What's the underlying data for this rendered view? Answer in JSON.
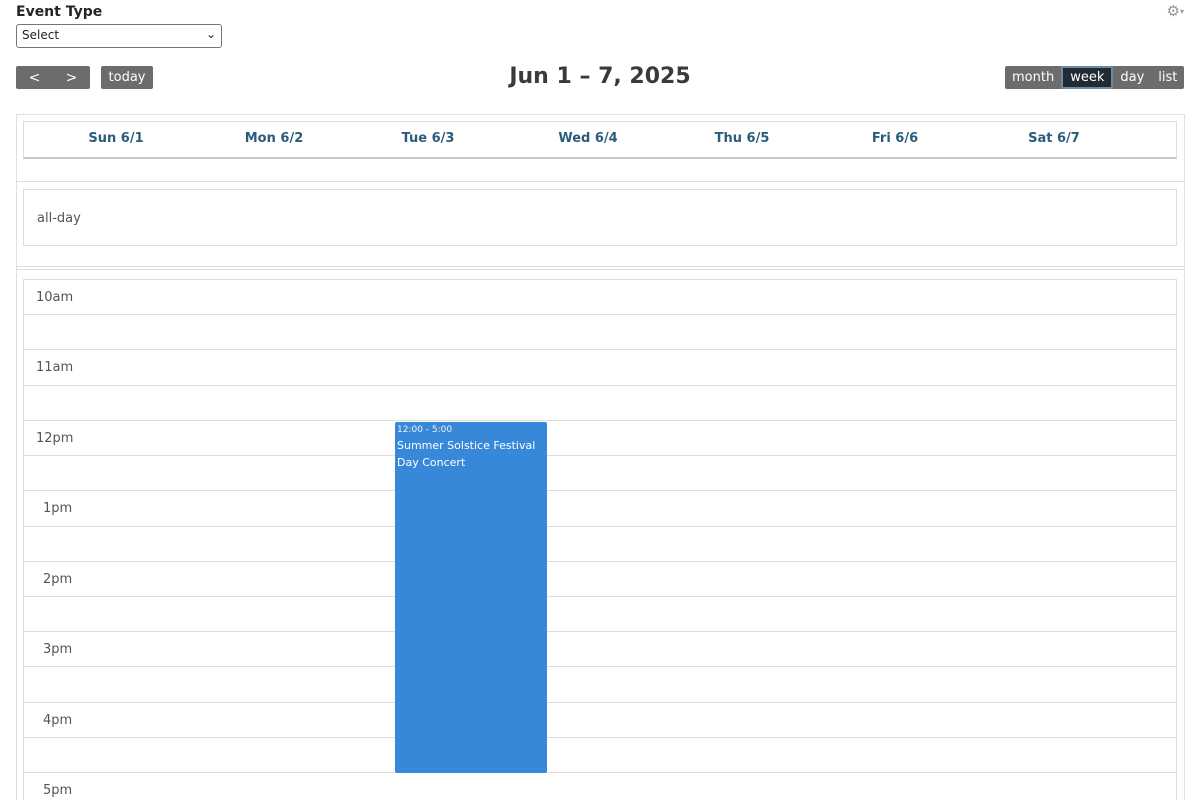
{
  "filter": {
    "label": "Event Type",
    "selected": "Select"
  },
  "icons": {
    "settings": "gear-icon",
    "prev": "chevron-left-icon",
    "next": "chevron-right-icon",
    "dropdown": "chevron-down-icon"
  },
  "toolbar": {
    "prev_label": "<",
    "next_label": ">",
    "today_label": "today",
    "title": "Jun 1 – 7, 2025",
    "views": [
      "month",
      "week",
      "day",
      "list"
    ],
    "active_view": "week"
  },
  "days": [
    "Sun 6/1",
    "Mon 6/2",
    "Tue 6/3",
    "Wed 6/4",
    "Thu 6/5",
    "Fri 6/6",
    "Sat 6/7"
  ],
  "allday_label": "all-day",
  "time_slots": [
    "10am",
    "11am",
    "12pm",
    "1pm",
    "2pm",
    "3pm",
    "4pm",
    "5pm"
  ],
  "events": [
    {
      "day": "Tue 6/3",
      "time": "12:00 - 5:00",
      "title": "Summer Solstice Festival Day Concert",
      "color": "#3788d8"
    }
  ],
  "colors": {
    "button_bg": "#6c6c6c",
    "button_active": "#212b34",
    "day_header_text": "#2a5d7a",
    "event_blue": "#3788d8"
  }
}
